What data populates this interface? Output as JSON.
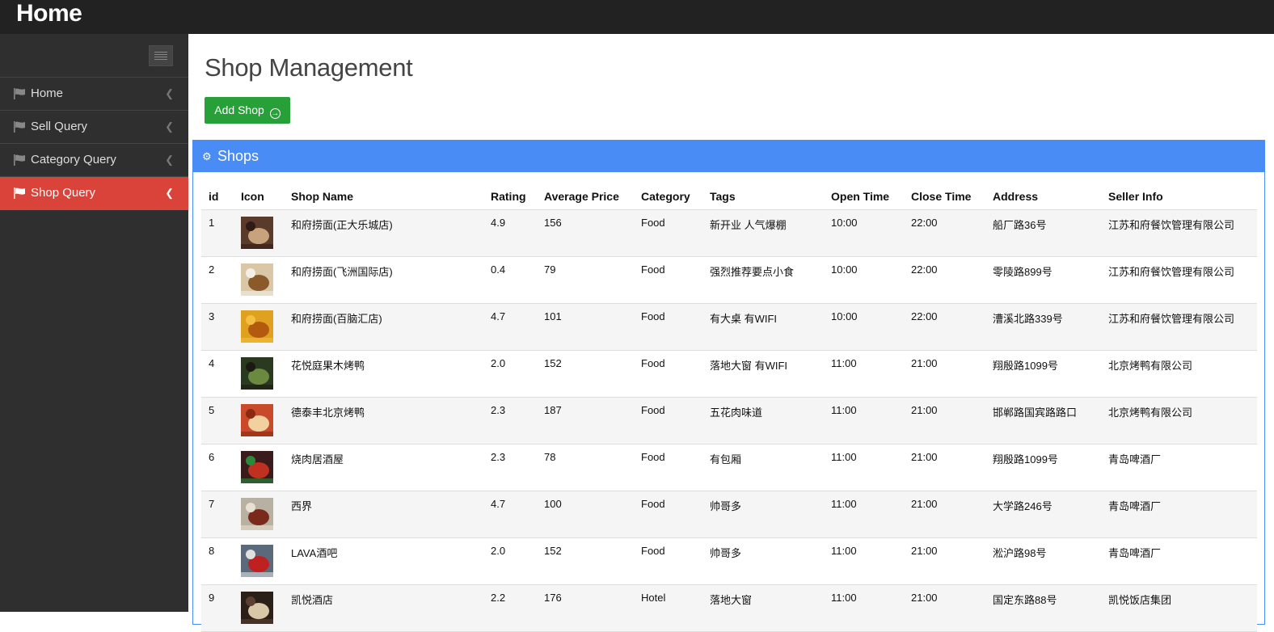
{
  "app": {
    "brand": "Home"
  },
  "sidebar": {
    "items": [
      {
        "label": "Home",
        "active": false
      },
      {
        "label": "Sell Query",
        "active": false
      },
      {
        "label": "Category Query",
        "active": false
      },
      {
        "label": "Shop Query",
        "active": true
      }
    ]
  },
  "main": {
    "title": "Shop Management",
    "add_button": "Add Shop",
    "panel_title": "Shops"
  },
  "table": {
    "headers": [
      "id",
      "Icon",
      "Shop Name",
      "Rating",
      "Average Price",
      "Category",
      "Tags",
      "Open Time",
      "Close Time",
      "Address",
      "Seller Info"
    ],
    "rows": [
      {
        "id": "1",
        "icon": "shop-photo",
        "name": "和府捞面(正大乐城店)",
        "rating": "4.9",
        "price": "156",
        "category": "Food",
        "tags": "新开业 人气爆棚",
        "open": "10:00",
        "close": "22:00",
        "address": "船厂路36号",
        "seller": "江苏和府餐饮管理有限公司"
      },
      {
        "id": "2",
        "icon": "shop-photo",
        "name": "和府捞面(飞洲国际店)",
        "rating": "0.4",
        "price": "79",
        "category": "Food",
        "tags": "强烈推荐要点小食",
        "open": "10:00",
        "close": "22:00",
        "address": "零陵路899号",
        "seller": "江苏和府餐饮管理有限公司"
      },
      {
        "id": "3",
        "icon": "shop-photo",
        "name": "和府捞面(百脑汇店)",
        "rating": "4.7",
        "price": "101",
        "category": "Food",
        "tags": "有大桌 有WIFI",
        "open": "10:00",
        "close": "22:00",
        "address": "漕溪北路339号",
        "seller": "江苏和府餐饮管理有限公司"
      },
      {
        "id": "4",
        "icon": "shop-photo",
        "name": "花悦庭果木烤鸭",
        "rating": "2.0",
        "price": "152",
        "category": "Food",
        "tags": "落地大窗 有WIFI",
        "open": "11:00",
        "close": "21:00",
        "address": "翔殷路1099号",
        "seller": "北京烤鸭有限公司"
      },
      {
        "id": "5",
        "icon": "shop-photo",
        "name": "德泰丰北京烤鸭",
        "rating": "2.3",
        "price": "187",
        "category": "Food",
        "tags": "五花肉味道",
        "open": "11:00",
        "close": "21:00",
        "address": "邯郸路国宾路路口",
        "seller": "北京烤鸭有限公司"
      },
      {
        "id": "6",
        "icon": "shop-photo",
        "name": "烧肉居酒屋",
        "rating": "2.3",
        "price": "78",
        "category": "Food",
        "tags": "有包厢",
        "open": "11:00",
        "close": "21:00",
        "address": "翔殷路1099号",
        "seller": "青岛啤酒厂"
      },
      {
        "id": "7",
        "icon": "shop-photo",
        "name": "西界",
        "rating": "4.7",
        "price": "100",
        "category": "Food",
        "tags": "帅哥多",
        "open": "11:00",
        "close": "21:00",
        "address": "大学路246号",
        "seller": "青岛啤酒厂"
      },
      {
        "id": "8",
        "icon": "shop-photo",
        "name": "LAVA酒吧",
        "rating": "2.0",
        "price": "152",
        "category": "Food",
        "tags": "帅哥多",
        "open": "11:00",
        "close": "21:00",
        "address": "淞沪路98号",
        "seller": "青岛啤酒厂"
      },
      {
        "id": "9",
        "icon": "shop-photo",
        "name": "凯悦酒店",
        "rating": "2.2",
        "price": "176",
        "category": "Hotel",
        "tags": "落地大窗",
        "open": "11:00",
        "close": "21:00",
        "address": "国定东路88号",
        "seller": "凯悦饭店集团"
      }
    ]
  },
  "colors": {
    "topbar": "#222222",
    "sidebar": "#2f2f2f",
    "active_nav": "#d9433a",
    "add_button": "#28a03a",
    "panel_header": "#4a8cf5"
  },
  "icons": {
    "nav": "flag-icon",
    "nav_arrow": "chevron-left-icon",
    "toggle": "menu-icon",
    "add": "arrow-circle-right-icon",
    "panel": "gears-icon"
  }
}
